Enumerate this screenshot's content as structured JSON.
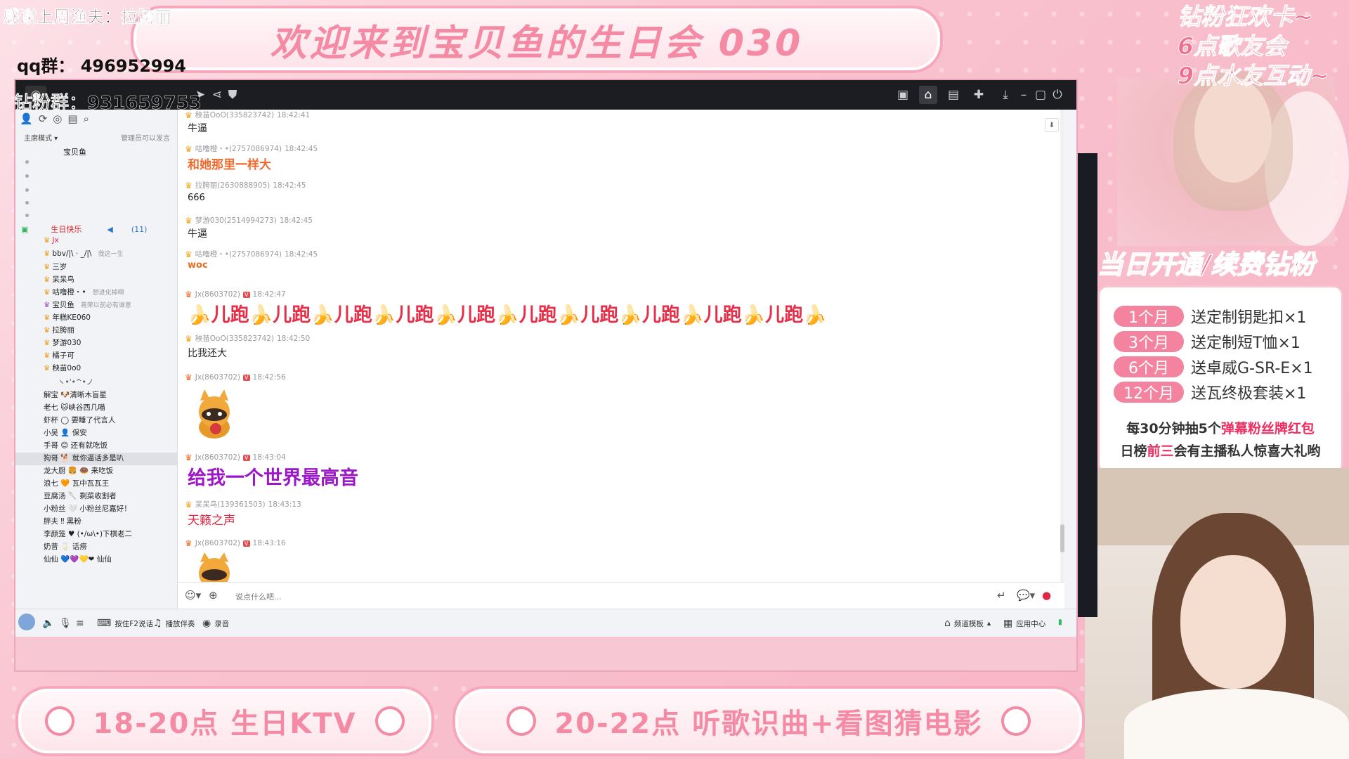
{
  "overlay": {
    "thanks": "感谢上周渔夫：拉胯丽",
    "title": "欢迎来到宝贝鱼的生日会 030",
    "qq_group": "qq群： 496952994",
    "diamond_group": "钻粉群：931659753",
    "promo_lines": [
      "钻粉狂欢卡~",
      "6点歌友会",
      "9点水友互动~"
    ],
    "membership_banner": "当日开通/续费钻粉",
    "rewards": [
      {
        "period": "1个月",
        "reward": "送定制钥匙扣×1"
      },
      {
        "period": "3个月",
        "reward": "送定制短T恤×1"
      },
      {
        "period": "6个月",
        "reward": "送卓威G-SR-E×1"
      },
      {
        "period": "12个月",
        "reward": "送瓦终极套装×1"
      }
    ],
    "reward_note1": {
      "pre": "每30分钟抽5个",
      "hl": "弹幕粉丝牌红包"
    },
    "reward_note2": {
      "pre": "日榜",
      "hl": "前三",
      "post": "会有主播私人惊喜大礼哟"
    },
    "schedule_left": "18-20点 生日KTV",
    "schedule_right": "20-22点 听歌识曲+看图猜电影"
  },
  "sidebar": {
    "mode": "主席模式 ▾",
    "mode_right": "管理员可以发言",
    "host": "宝贝鱼",
    "channel": "生日快乐",
    "channel_count": "(11)",
    "users": [
      {
        "name": "Jx",
        "tag": ""
      },
      {
        "name": "bbv/|\\ · _/|\\",
        "tag": "我这一生"
      },
      {
        "name": "三岁",
        "tag": ""
      },
      {
        "name": "呆呆鸟",
        "tag": ""
      },
      {
        "name": "咕噜橙・•",
        "tag": "想进化掉啊"
      },
      {
        "name": "宝贝鱼",
        "tag": "蒋荣以前必有谁意"
      },
      {
        "name": "年糕KE060",
        "tag": ""
      },
      {
        "name": "拉胯丽",
        "tag": ""
      },
      {
        "name": "梦游030",
        "tag": ""
      },
      {
        "name": "橘子可",
        "tag": ""
      },
      {
        "name": "秧苗0o0",
        "tag": ""
      }
    ],
    "lobby_title": "ヽ•'•^•ノ",
    "members": [
      "解宝 🐶清晰木盲星",
      "老七 🐱峡谷西几喵",
      "虾杯 ◯ 要睡了代言人",
      "小吴 👤 保安",
      "手哥 😊 还有就吃饭",
      "狗哥 🐕 就你逼话多是叭",
      "龙大厨 🍔 🍩 来吃饭",
      "浪七 🧡 瓦中瓦瓦王",
      "豆腐汤 🥄 剩菜收割者",
      "小粉丝 🤍 小粉丝尼嘉好！",
      "胖夫 ‼ 黑粉",
      "李颜笼 ♥ (•/ω\\•)下棋老二",
      "奶昔 🥛 话痨",
      "仙仙 💙💜💛❤ 仙仙"
    ]
  },
  "chat": {
    "messages": [
      {
        "user": "秧苗OoO(335823742)",
        "time": "18:42:41",
        "text": "牛逼",
        "style": "normal"
      },
      {
        "user": "咕噜橙・•(2757086974)",
        "time": "18:42:45",
        "text": "和她那里一样大",
        "style": "orange"
      },
      {
        "user": "拉胯丽(2630888905)",
        "time": "18:42:45",
        "text": "666",
        "style": "normal"
      },
      {
        "user": "梦游030(2514994273)",
        "time": "18:42:45",
        "text": "牛逼",
        "style": "normal"
      },
      {
        "user": "咕噜橙・•(2757086974)",
        "time": "18:42:45",
        "text": "woc",
        "style": "woc"
      },
      {
        "user": "Jx(8603702)",
        "time": "18:42:47",
        "text": "🍌儿跑🍌儿跑🍌儿跑🍌儿跑🍌儿跑🍌儿跑🍌儿跑🍌儿跑🍌儿跑🍌儿跑🍌",
        "style": "big"
      },
      {
        "user": "秧苗OoO(335823742)",
        "time": "18:42:50",
        "text": "比我还大",
        "style": "normal"
      },
      {
        "user": "Jx(8603702)",
        "time": "18:42:56",
        "text": "",
        "style": "sticker"
      },
      {
        "user": "Jx(8603702)",
        "time": "18:43:04",
        "text": "给我一个世界最高音",
        "style": "purple"
      },
      {
        "user": "呆呆鸟(139361503)",
        "time": "18:43:13",
        "text": "天籁之声",
        "style": "red"
      },
      {
        "user": "Jx(8603702)",
        "time": "18:43:16",
        "text": "",
        "style": "sticker"
      }
    ],
    "input_placeholder": "说点什么吧..."
  },
  "statusbar": {
    "push_to_talk": "按住F2说话",
    "accompaniment": "播放伴奏",
    "record": "录音",
    "channel_template": "频道模板",
    "app_center": "应用中心"
  },
  "icons": {
    "titlebar": [
      "video-icon",
      "home-icon",
      "grid-icon",
      "gamepad-icon",
      "download-icon",
      "minimize-icon",
      "maximize-icon",
      "power-icon"
    ]
  },
  "colors": {
    "accent_pink": "#f3839e",
    "chat_red": "#e6304a",
    "chat_purple": "#9c17c7",
    "chat_orange": "#ef6a2c"
  }
}
